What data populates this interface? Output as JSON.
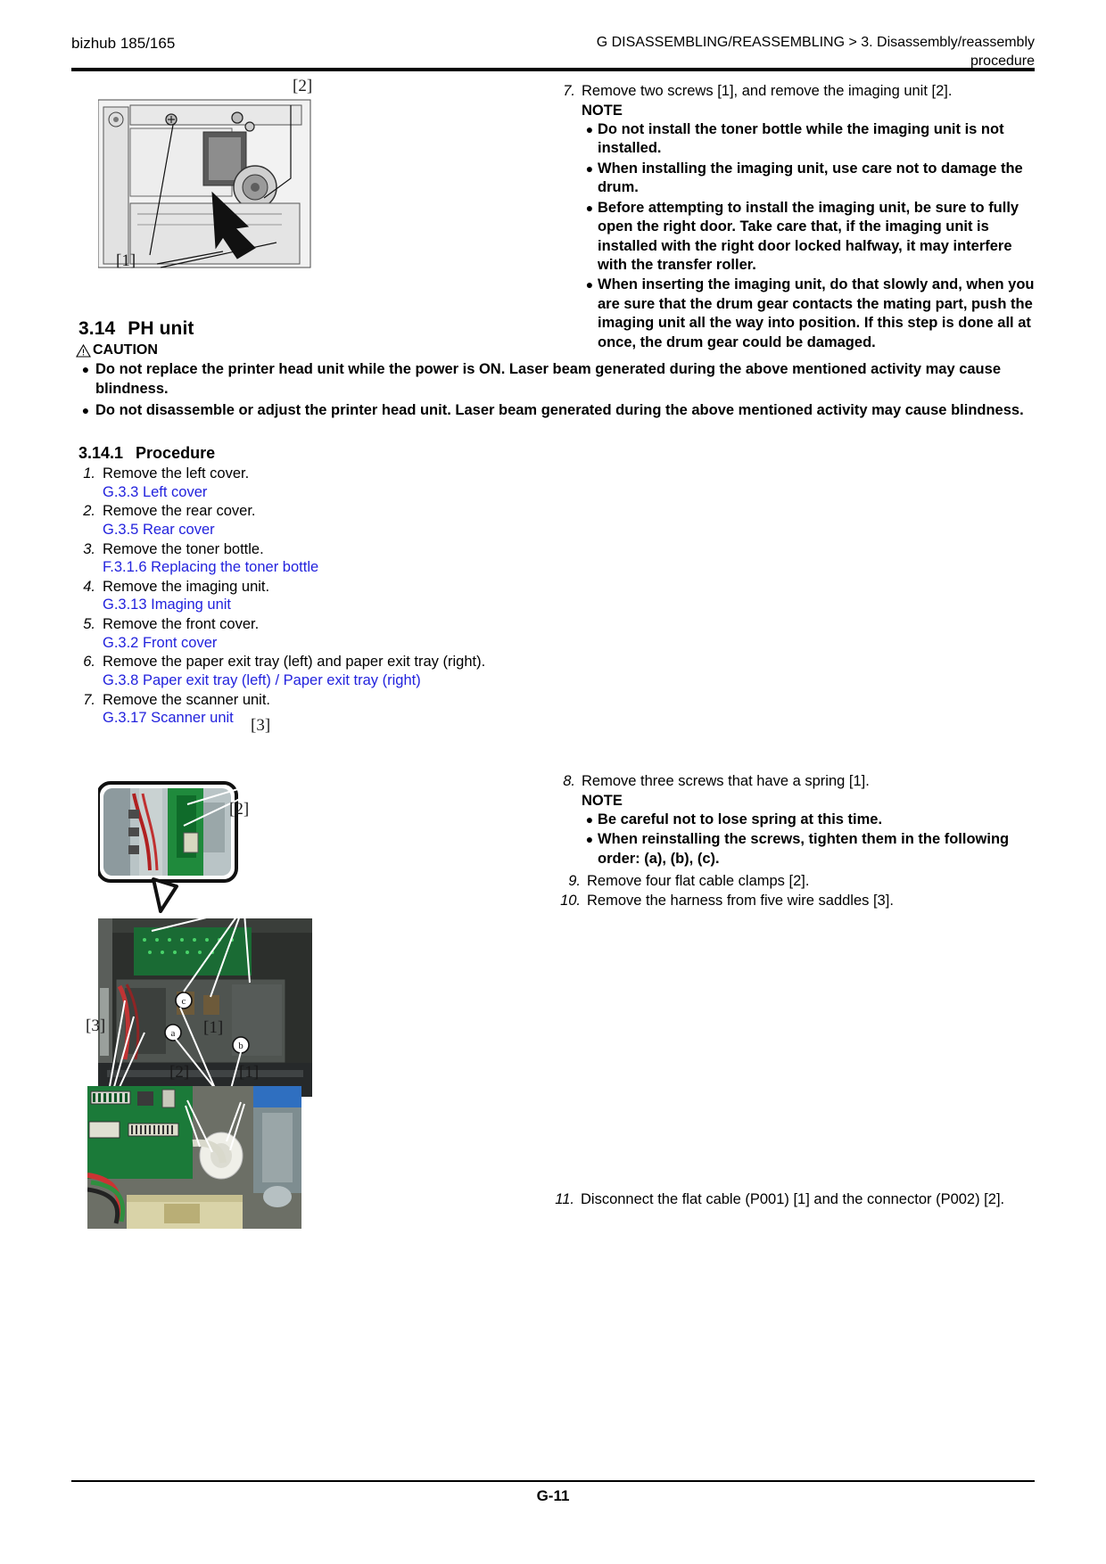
{
  "header": {
    "model": "bizhub 185/165",
    "breadcrumb_line1": "G  DISASSEMBLING/REASSEMBLING > 3.  Disassembly/reassembly",
    "breadcrumb_line2": "procedure"
  },
  "footer": {
    "page_number": "G-11"
  },
  "step7": {
    "number": "7.",
    "text": "Remove two screws [1], and remove the imaging unit [2].",
    "note_label": "NOTE",
    "notes": [
      "Do not install the toner bottle while the imaging unit is not installed.",
      "When installing the imaging unit, use care not to damage the drum.",
      "Before attempting to install the imaging unit, be sure to fully open the right door. Take care that, if the imaging unit is installed with the right door locked halfway, it may interfere with the transfer roller.",
      "When inserting the imaging unit, do that slowly and, when you are sure that the drum gear contacts the mating part, push the imaging unit all the way into position. If this step is done all at once, the drum gear could be damaged."
    ]
  },
  "section": {
    "number": "3.14",
    "title": "PH unit"
  },
  "caution": {
    "label": "CAUTION",
    "icon": "warning-triangle-icon",
    "items": [
      "Do not replace the printer head unit while the power is ON. Laser beam generated during the above mentioned activity may cause blindness.",
      "Do not disassemble or adjust the printer head unit. Laser beam generated during the above mentioned activity may cause blindness."
    ]
  },
  "subsection": {
    "number": "3.14.1",
    "title": "Procedure"
  },
  "procedure": {
    "link_color": "#2222DD",
    "items": [
      {
        "num": "1.",
        "text": "Remove the left cover.",
        "link": "G.3.3 Left cover"
      },
      {
        "num": "2.",
        "text": "Remove the rear cover.",
        "link": "G.3.5 Rear cover"
      },
      {
        "num": "3.",
        "text": "Remove the toner bottle.",
        "link": "F.3.1.6 Replacing the toner bottle"
      },
      {
        "num": "4.",
        "text": "Remove the imaging unit.",
        "link": "G.3.13 Imaging unit"
      },
      {
        "num": "5.",
        "text": "Remove the front cover.",
        "link": "G.3.2 Front cover"
      },
      {
        "num": "6.",
        "text": "Remove the paper exit tray (left) and paper exit tray (right).",
        "link": "G.3.8 Paper exit tray (left) / Paper exit tray (right)"
      },
      {
        "num": "7.",
        "text": "Remove the scanner unit.",
        "link": "G.3.17 Scanner unit"
      }
    ]
  },
  "step8": {
    "number": "8.",
    "text": "Remove three screws that have a spring [1].",
    "note_label": "NOTE",
    "notes": [
      "Be careful not to lose spring at this time.",
      "When reinstalling the screws, tighten them in the following order: (a), (b), (c)."
    ]
  },
  "step9": {
    "number": "9.",
    "text": "Remove four flat cable clamps [2]."
  },
  "step10": {
    "number": "10.",
    "text": "Remove the harness from five wire saddles [3]."
  },
  "step11": {
    "number": "11.",
    "text": "Disconnect the flat cable (P001) [1] and the connector (P002) [2]."
  },
  "figures": {
    "imaging_unit": {
      "name": "imaging-unit-photo",
      "callouts": [
        "[2]",
        "[1]"
      ]
    },
    "ph_unit_main": {
      "name": "ph-unit-photo",
      "callouts": [
        "[3]",
        "[2]",
        "[3]",
        "[1]"
      ],
      "screw_labels": [
        "c",
        "a",
        "b"
      ]
    },
    "connector": {
      "name": "connector-photo",
      "callouts": [
        "[2]",
        "[1]"
      ]
    }
  }
}
